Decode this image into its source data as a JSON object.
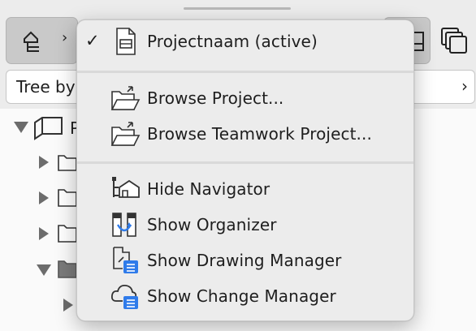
{
  "toolbar": {
    "left_button_icon": "navigator-tree-icon",
    "left_chevron": "›",
    "right_button_icon": "layout-icon",
    "stacked_windows_icon": "stacked-windows-icon"
  },
  "tree_select": {
    "label": "Tree by",
    "arrow": "›"
  },
  "tree": {
    "root_label": "P",
    "rows": [
      {
        "icon": "folder-icon",
        "expanded": false
      },
      {
        "icon": "folder-icon",
        "expanded": false
      },
      {
        "icon": "folder-icon",
        "expanded": false
      },
      {
        "icon": "folder-filled-icon",
        "expanded": true
      },
      {
        "icon": "folder-icon",
        "expanded": false
      }
    ]
  },
  "menu": {
    "check_mark": "✓",
    "items": [
      {
        "label": "Projectnaam (active)",
        "icon": "project-file-icon",
        "checked": true
      },
      {
        "label": "Browse Project...",
        "icon": "folder-browse-icon"
      },
      {
        "label": "Browse Teamwork Project...",
        "icon": "folder-browse-teamwork-icon"
      },
      {
        "label": "Hide Navigator",
        "icon": "navigator-tree-icon"
      },
      {
        "label": "Show Organizer",
        "icon": "organizer-icon"
      },
      {
        "label": "Show Drawing Manager",
        "icon": "drawing-manager-icon"
      },
      {
        "label": "Show Change Manager",
        "icon": "change-manager-icon"
      }
    ]
  },
  "colors": {
    "accent": "#2f7bea",
    "menu_bg": "#ececec",
    "window_bg": "#ececec"
  }
}
